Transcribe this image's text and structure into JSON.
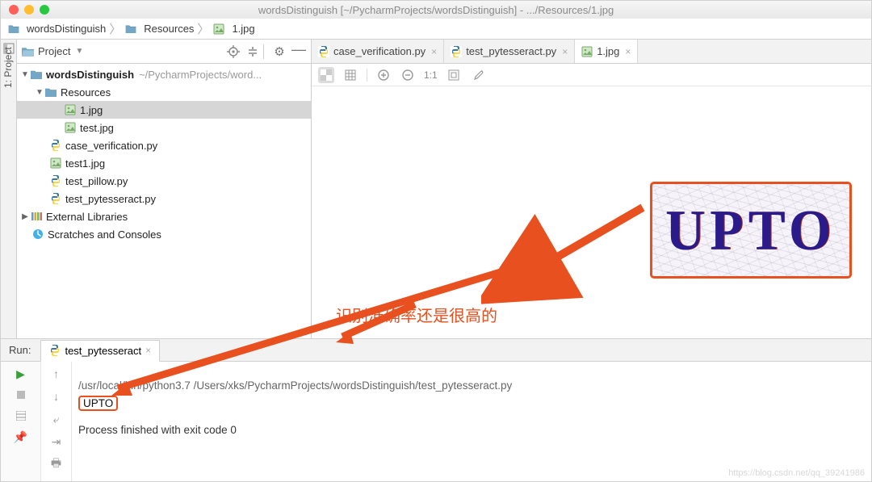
{
  "title": "wordsDistinguish [~/PycharmProjects/wordsDistinguish] - .../Resources/1.jpg",
  "breadcrumb": {
    "root": "wordsDistinguish",
    "mid": "Resources",
    "leaf": "1.jpg"
  },
  "project_toolwindow": {
    "title": "Project",
    "vertical_label": "1: Project"
  },
  "tree": {
    "root": {
      "name": "wordsDistinguish",
      "path": "~/PycharmProjects/word..."
    },
    "resources": "Resources",
    "items": {
      "f0": "1.jpg",
      "f1": "test.jpg",
      "f2": "case_verification.py",
      "f3": "test1.jpg",
      "f4": "test_pillow.py",
      "f5": "test_pytesseract.py"
    },
    "ext_lib": "External Libraries",
    "scratches": "Scratches and Consoles"
  },
  "tabs": {
    "t0": "case_verification.py",
    "t1": "test_pytesseract.py",
    "t2": "1.jpg"
  },
  "img_toolbar": {
    "scale": "1:1"
  },
  "captcha_text": "UPTO",
  "annotation": "识别准确率还是很高的",
  "run": {
    "label": "Run:",
    "tab": "test_pytesseract",
    "cmd": "/usr/local/bin/python3.7 /Users/xks/PycharmProjects/wordsDistinguish/test_pytesseract.py",
    "out": "UPTO",
    "exit": "Process finished with exit code 0"
  },
  "watermark": "https://blog.csdn.net/qq_39241986"
}
